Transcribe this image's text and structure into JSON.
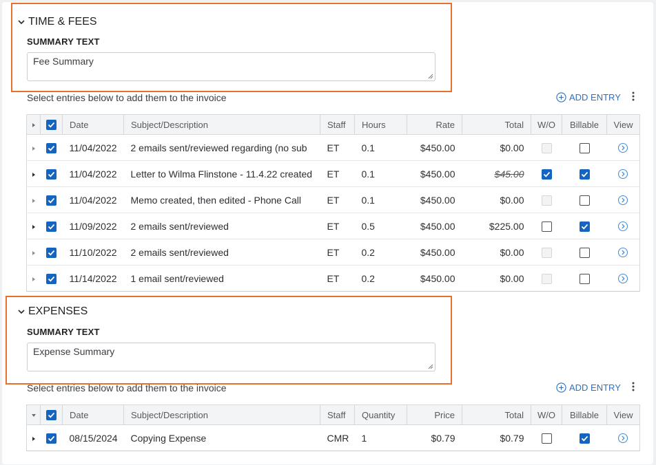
{
  "time_fees": {
    "title": "TIME & FEES",
    "summary_label": "SUMMARY TEXT",
    "summary_value": "Fee Summary",
    "hint": "Select entries below to add them to the invoice",
    "add_entry": "ADD ENTRY",
    "columns": [
      "Date",
      "Subject/Description",
      "Staff",
      "Hours",
      "Rate",
      "Total",
      "W/O",
      "Billable",
      "View"
    ],
    "rows": [
      {
        "date": "11/04/2022",
        "subject": "2 emails sent/reviewed regarding (no sub",
        "staff": "ET",
        "hours": "0.1",
        "rate": "$450.00",
        "total": "$0.00",
        "strike": false,
        "wo": "disabled",
        "billable": false,
        "expandable": false
      },
      {
        "date": "11/04/2022",
        "subject": "Letter to Wilma Flinstone - 11.4.22 created",
        "staff": "ET",
        "hours": "0.1",
        "rate": "$450.00",
        "total": "$45.00",
        "strike": true,
        "wo": "checked",
        "billable": true,
        "expandable": true
      },
      {
        "date": "11/04/2022",
        "subject": "Memo created, then edited - Phone Call",
        "staff": "ET",
        "hours": "0.1",
        "rate": "$450.00",
        "total": "$0.00",
        "strike": false,
        "wo": "disabled",
        "billable": false,
        "expandable": false
      },
      {
        "date": "11/09/2022",
        "subject": "2 emails sent/reviewed",
        "staff": "ET",
        "hours": "0.5",
        "rate": "$450.00",
        "total": "$225.00",
        "strike": false,
        "wo": "unchecked",
        "billable": true,
        "expandable": true
      },
      {
        "date": "11/10/2022",
        "subject": "2 emails sent/reviewed",
        "staff": "ET",
        "hours": "0.2",
        "rate": "$450.00",
        "total": "$0.00",
        "strike": false,
        "wo": "disabled",
        "billable": false,
        "expandable": false
      },
      {
        "date": "11/14/2022",
        "subject": "1 email sent/reviewed",
        "staff": "ET",
        "hours": "0.2",
        "rate": "$450.00",
        "total": "$0.00",
        "strike": false,
        "wo": "disabled",
        "billable": false,
        "expandable": false
      }
    ]
  },
  "expenses": {
    "title": "EXPENSES",
    "summary_label": "SUMMARY TEXT",
    "summary_value": "Expense Summary",
    "hint": "Select entries below to add them to the invoice",
    "add_entry": "ADD ENTRY",
    "columns": [
      "Date",
      "Subject/Description",
      "Staff",
      "Quantity",
      "Price",
      "Total",
      "W/O",
      "Billable",
      "View"
    ],
    "rows": [
      {
        "date": "08/15/2024",
        "subject": "Copying Expense",
        "staff": "CMR",
        "quantity": "1",
        "price": "$0.79",
        "total": "$0.79",
        "wo": "unchecked",
        "billable": true
      }
    ]
  },
  "colors": {
    "accent": "#1565c0",
    "highlight": "#e8702a",
    "link": "#2c6fc2"
  }
}
